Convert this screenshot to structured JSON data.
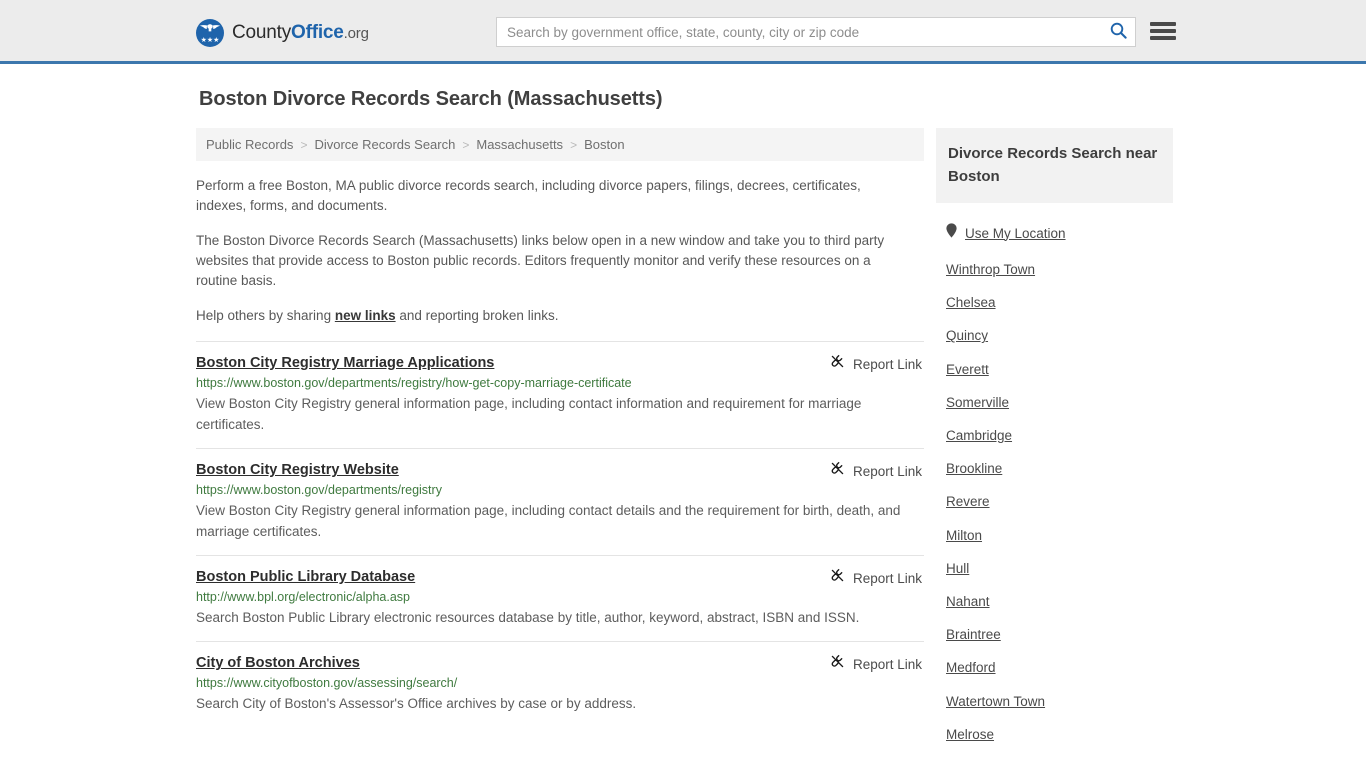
{
  "header": {
    "logo": {
      "text_county": "County",
      "text_office": "Office",
      "text_org": ".org",
      "stars": "★★★",
      "icon": "eagle-seal-icon"
    },
    "search": {
      "placeholder": "Search by government office, state, county, city or zip code",
      "value": "",
      "icon": "search-icon"
    },
    "menu_icon": "hamburger-menu-icon",
    "accent_color": "#3c77ad"
  },
  "page": {
    "title": "Boston Divorce Records Search (Massachusetts)"
  },
  "breadcrumb": {
    "separator": ">",
    "items": [
      {
        "label": "Public Records"
      },
      {
        "label": "Divorce Records Search"
      },
      {
        "label": "Massachusetts"
      },
      {
        "label": "Boston"
      }
    ]
  },
  "intro": {
    "paragraph1": "Perform a free Boston, MA public divorce records search, including divorce papers, filings, decrees, certificates, indexes, forms, and documents.",
    "paragraph2": "The Boston Divorce Records Search (Massachusetts) links below open in a new window and take you to third party websites that provide access to Boston public records. Editors frequently monitor and verify these resources on a routine basis.",
    "paragraph3_pre": "Help others by sharing ",
    "paragraph3_link": "new links",
    "paragraph3_post": " and reporting broken links."
  },
  "results": {
    "report_label": "Report Link",
    "report_icon": "broken-link-icon",
    "items": [
      {
        "title": "Boston City Registry Marriage Applications",
        "url": "https://www.boston.gov/departments/registry/how-get-copy-marriage-certificate",
        "description": "View Boston City Registry general information page, including contact information and requirement for marriage certificates."
      },
      {
        "title": "Boston City Registry Website",
        "url": "https://www.boston.gov/departments/registry",
        "description": "View Boston City Registry general information page, including contact details and the requirement for birth, death, and marriage certificates."
      },
      {
        "title": "Boston Public Library Database",
        "url": "http://www.bpl.org/electronic/alpha.asp",
        "description": "Search Boston Public Library electronic resources database by title, author, keyword, abstract, ISBN and ISSN."
      },
      {
        "title": "City of Boston Archives",
        "url": "https://www.cityofboston.gov/assessing/search/",
        "description": "Search City of Boston's Assessor's Office archives by case or by address."
      }
    ]
  },
  "sidebar": {
    "heading": "Divorce Records Search near Boston",
    "use_my_location": {
      "label": "Use My Location",
      "icon": "map-pin-icon"
    },
    "links": [
      {
        "label": "Winthrop Town"
      },
      {
        "label": "Chelsea"
      },
      {
        "label": "Quincy"
      },
      {
        "label": "Everett"
      },
      {
        "label": "Somerville"
      },
      {
        "label": "Cambridge"
      },
      {
        "label": "Brookline"
      },
      {
        "label": "Revere"
      },
      {
        "label": "Milton"
      },
      {
        "label": "Hull"
      },
      {
        "label": "Nahant"
      },
      {
        "label": "Braintree"
      },
      {
        "label": "Medford"
      },
      {
        "label": "Watertown Town"
      },
      {
        "label": "Melrose"
      }
    ]
  }
}
